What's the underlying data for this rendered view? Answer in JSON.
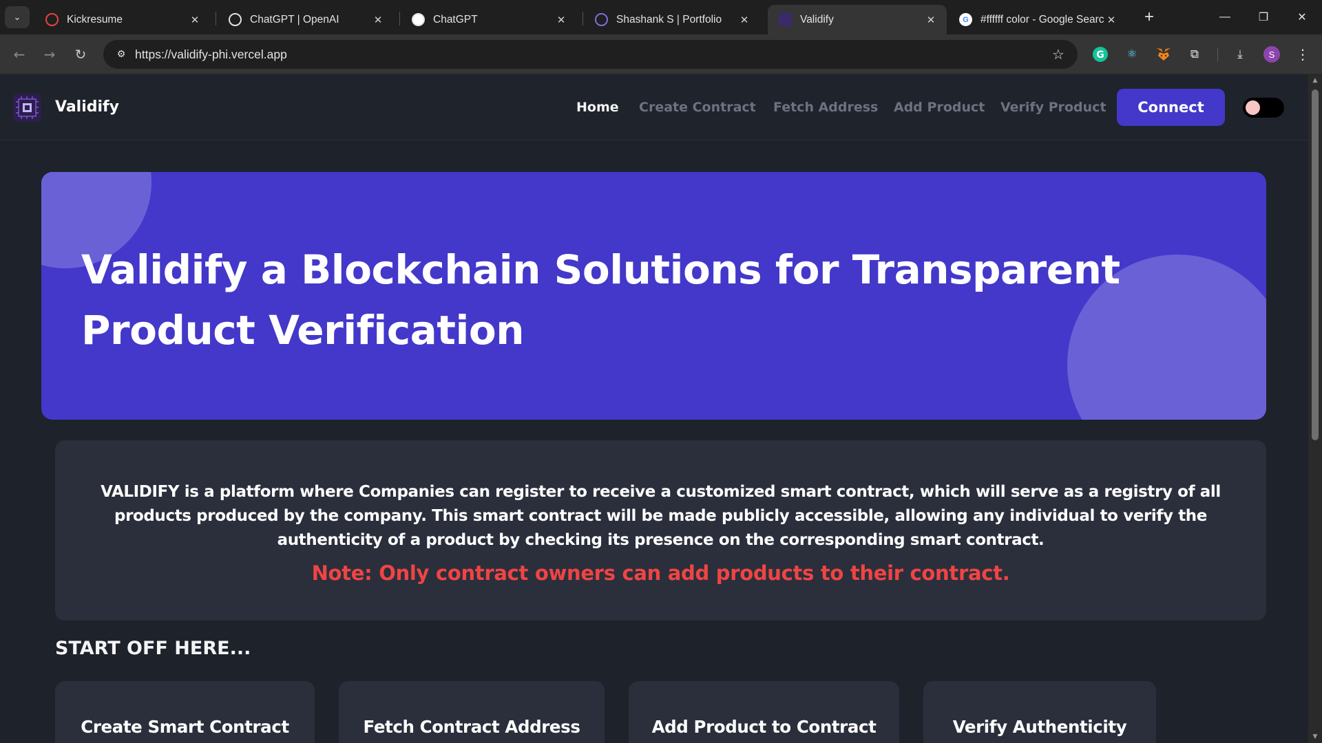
{
  "browser": {
    "tabs": [
      {
        "title": "Kickresume",
        "icon": "kickresume-icon",
        "active": false
      },
      {
        "title": "ChatGPT | OpenAI",
        "icon": "openai-icon",
        "active": false
      },
      {
        "title": "ChatGPT",
        "icon": "openai-icon",
        "active": false
      },
      {
        "title": "Shashank S | Portfolio",
        "icon": "portfolio-icon",
        "active": false
      },
      {
        "title": "Validify",
        "icon": "validify-icon",
        "active": true
      },
      {
        "title": "#ffffff color - Google Searc",
        "icon": "google-icon",
        "active": false
      }
    ],
    "url": "https://validify-phi.vercel.app",
    "profile_initial": "S"
  },
  "site": {
    "brand": "Validify",
    "nav": {
      "home": "Home",
      "create_contract": "Create Contract",
      "fetch_address": "Fetch Address",
      "add_product": "Add Product",
      "verify_product": "Verify Product"
    },
    "connect_label": "Connect",
    "theme_toggle": "off"
  },
  "hero": {
    "title": "Validify a Blockchain Solutions for Transparent Product Verification"
  },
  "about": {
    "text": "VALIDIFY is a platform where Companies can register to receive a customized smart contract, which will serve as a registry of all products produced by the company. This smart contract will be made publicly accessible, allowing any individual to verify the authenticity of a product by checking its presence on the corresponding smart contract.",
    "note": "Note: Only contract owners can add products to their contract."
  },
  "start": {
    "heading": "START OFF HERE...",
    "cards": [
      {
        "title": "Create Smart Contract"
      },
      {
        "title": "Fetch Contract Address"
      },
      {
        "title": "Add Product to Contract"
      },
      {
        "title": "Verify Authenticity"
      }
    ]
  },
  "colors": {
    "accent": "#4338ca",
    "accent_light": "#6b61d6",
    "page_bg": "#1e222b",
    "card_bg": "#2a2f3b",
    "note_red": "#f04444"
  }
}
